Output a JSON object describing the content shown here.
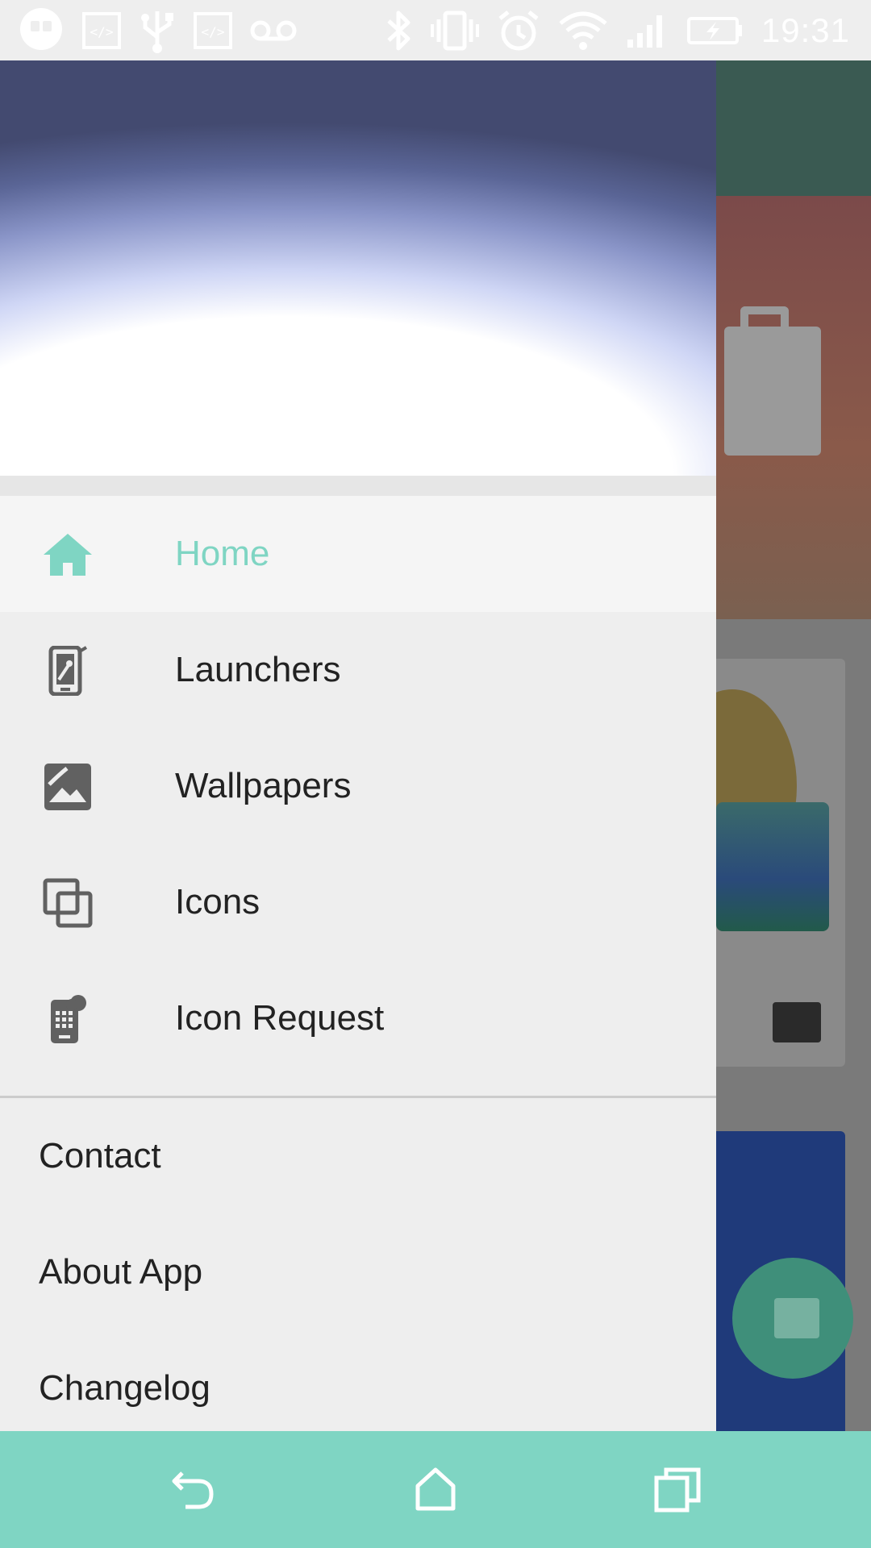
{
  "status_bar": {
    "time": "19:31",
    "left_icons": [
      "hangouts-icon",
      "code-icon",
      "usb-icon",
      "code-icon",
      "voicemail-icon"
    ],
    "right_icons": [
      "bluetooth-icon",
      "vibrate-icon",
      "alarm-icon",
      "wifi-icon",
      "signal-icon",
      "battery-charging-icon"
    ]
  },
  "drawer": {
    "nav_items": [
      {
        "label": "Home",
        "icon": "home-icon",
        "active": true
      },
      {
        "label": "Launchers",
        "icon": "launcher-phone-icon",
        "active": false
      },
      {
        "label": "Wallpapers",
        "icon": "wallpaper-icon",
        "active": false
      },
      {
        "label": "Icons",
        "icon": "icons-stack-icon",
        "active": false
      },
      {
        "label": "Icon Request",
        "icon": "icon-request-icon",
        "active": false
      }
    ],
    "secondary_items": [
      {
        "label": "Contact"
      },
      {
        "label": "About App"
      },
      {
        "label": "Changelog"
      }
    ]
  },
  "navigation_bar": {
    "buttons": [
      "back-icon",
      "home-button-icon",
      "recents-icon"
    ]
  },
  "colors": {
    "accent": "#7fd5c3",
    "text_primary": "#222222",
    "drawer_bg": "#eeeeee",
    "active_row_bg": "#f5f5f5"
  }
}
